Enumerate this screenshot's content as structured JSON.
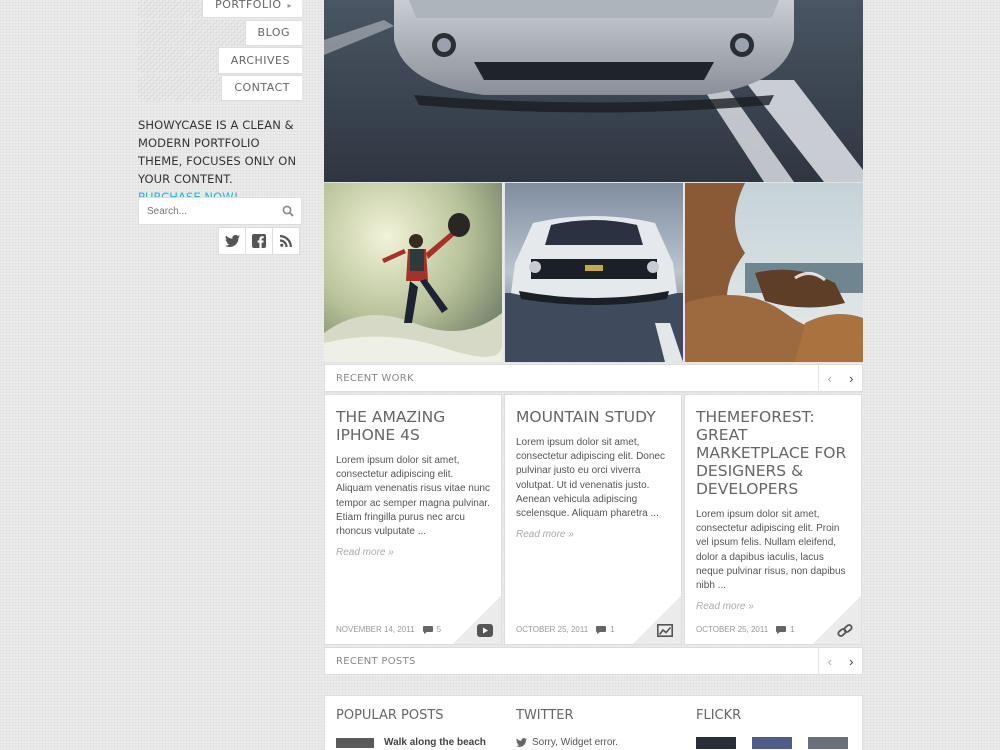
{
  "nav": {
    "items": [
      {
        "label": "PORTFOLIO",
        "has_submenu": true
      },
      {
        "label": "BLOG",
        "has_submenu": false
      },
      {
        "label": "ARCHIVES",
        "has_submenu": false
      },
      {
        "label": "CONTACT",
        "has_submenu": false
      }
    ]
  },
  "tagline": {
    "text": "SHOWYCASE IS A CLEAN & MODERN PORTFOLIO THEME, FOCUSES ONLY ON YOUR CONTENT.",
    "link": "PURCHASE NOW!"
  },
  "search": {
    "placeholder": "Search..."
  },
  "social": [
    "twitter-icon",
    "facebook-icon",
    "rss-icon"
  ],
  "sections": {
    "recent_work": "RECENT WORK",
    "recent_posts": "RECENT POSTS"
  },
  "posts": [
    {
      "title": "THE AMAZING IPHONE 4S",
      "excerpt": "Lorem ipsum dolor sit amet, consectetur adipiscing elit. Aliquam venenatis risus vitae nunc tempor ac semper magna pulvinar. Etiam fringilla purus nec arcu rhoncus vulputate ...",
      "more": "Read more »",
      "date": "NOVEMBER 14, 2011",
      "comments": "5",
      "format_icon": "video-icon"
    },
    {
      "title": "MOUNTAIN STUDY",
      "excerpt": "Lorem ipsum dolor sit amet, consectetur adipiscing elit. Donec pulvinar justo eu orci viverra volutpat. Ut id venenatis justo. Aenean vehicula adipiscing scelensque. Aliquam pharetra ...",
      "more": "Read more »",
      "date": "OCTOBER 25, 2011",
      "comments": "1",
      "format_icon": "image-icon"
    },
    {
      "title": "THEMEFOREST: GREAT MARKETPLACE FOR DESIGNERS & DEVELOPERS",
      "excerpt": "Lorem ipsum dolor sit amet, consectetur adipiscing elit. Proin vel ipsum felis. Nullam eleifend, dolor a dapibus iaculis, lacus neque pulvinar risus, non dapibus nibh ...",
      "more": "Read more »",
      "date": "OCTOBER 25, 2011",
      "comments": "1",
      "format_icon": "link-icon"
    }
  ],
  "footer": {
    "popular_title": "POPULAR POSTS",
    "popular_first": "Walk along the beach",
    "twitter_title": "TWITTER",
    "twitter_first": "Sorry, Widget error.",
    "flickr_title": "FLICKR"
  }
}
